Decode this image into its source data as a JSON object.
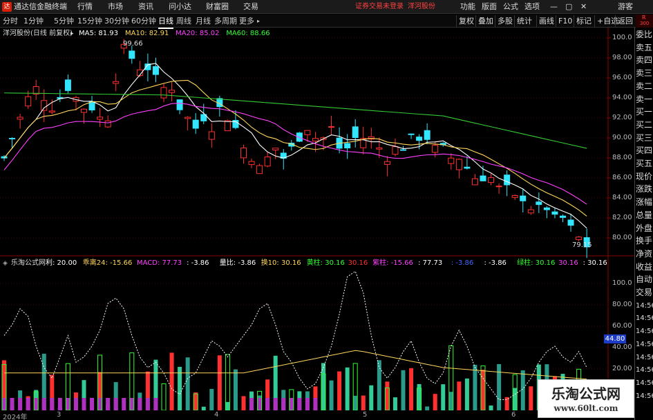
{
  "app": {
    "logo_text": "达",
    "title": "通达信金融终端",
    "menus": [
      "行情",
      "市场",
      "资讯",
      "问小达",
      "财富圈",
      "交易"
    ],
    "login_status": "证券交易未登录",
    "stock_name": "洋河股份",
    "right_menus": [
      "功能",
      "版面",
      "公式",
      "选项"
    ],
    "window_controls": [
      "—",
      "▢",
      "✕"
    ],
    "guest": "游客"
  },
  "timeframes": {
    "items": [
      "分时",
      "1分钟",
      "5分钟",
      "15分钟",
      "30分钟",
      "60分钟",
      "日线",
      "周线",
      "月线",
      "多周期",
      "更多"
    ],
    "active": "日线"
  },
  "toolbar_right": {
    "items": [
      "复权",
      "叠加",
      "多股",
      "统计",
      "画线",
      "F10",
      "标记",
      "+自选",
      "返回"
    ],
    "corner_top": "R",
    "corner_bottom": "300"
  },
  "price_panel": {
    "title": "洋河股份(日线 前复权)",
    "ma_items": [
      {
        "label": "MA5: 81.93",
        "color": "#ffffff"
      },
      {
        "label": "MA10: 82.91",
        "color": "#ffd75a"
      },
      {
        "label": "MA20: 85.02",
        "color": "#ff40ff"
      },
      {
        "label": "MA60: 88.66",
        "color": "#33ff33"
      }
    ],
    "high_label": "99.66",
    "low_label": "79.15",
    "y_labels": [
      "100.0",
      "98.00",
      "96.00",
      "94.00",
      "92.00",
      "90.00",
      "88.00",
      "86.00",
      "84.00",
      "82.00",
      "80.00"
    ]
  },
  "indicator_panel": {
    "title": "乐淘公式网",
    "items": [
      {
        "label": "利: 20.00",
        "color": "#ffffff"
      },
      {
        "label": "乖离24: -15.66",
        "color": "#ffd75a"
      },
      {
        "label": "MACD: 77.73",
        "color": "#ff40ff"
      },
      {
        "label": ": -3.86",
        "color": "#ffffff"
      },
      {
        "label": "量比: -3.86",
        "color": "#ffffff"
      },
      {
        "label": "换10: 30.16",
        "color": "#ffd75a"
      },
      {
        "label": "黄柱: 30.16",
        "color": "#33ff33"
      },
      {
        "label": "30.16",
        "color": "#ff3030"
      },
      {
        "label": "紫柱: -15.66",
        "color": "#ff40ff"
      },
      {
        "label": ": 77.73",
        "color": "#ffffff"
      },
      {
        "label": ": -3.86",
        "color": "#4466ff"
      },
      {
        "label": ": -3.86",
        "color": "#ffffff"
      },
      {
        "label": "绿柱: 30.16",
        "color": "#33ff33"
      },
      {
        "label": "30.16",
        "color": "#ff40ff"
      },
      {
        "label": ": 30.16",
        "color": "#ffffff"
      }
    ],
    "y_labels": [
      "100.0",
      "80.00",
      "60.00",
      "40.00",
      "20.00"
    ],
    "current_value": "44.80"
  },
  "x_axis": {
    "labels": [
      "2024年",
      "3",
      "4",
      "5",
      "6"
    ]
  },
  "sidebar": {
    "items": [
      "委比",
      "卖五",
      "卖四",
      "卖三",
      "卖二",
      "卖一",
      "买一",
      "买二",
      "买三",
      "买四",
      "买五",
      "现价",
      "涨跌",
      "涨幅",
      "总量",
      "外盘",
      "换手",
      "净资",
      "收益",
      "自动",
      "交易",
      "14:56",
      "14:56",
      "14:56",
      "14:56",
      "14:56",
      "14:56",
      "14:56",
      "14:56"
    ]
  },
  "watermark": {
    "title": "乐淘公式网",
    "url": "www.60lt.com"
  },
  "colors": {
    "up": "#ff3030",
    "down": "#33e6ff",
    "ma5": "#ffffff",
    "ma10": "#ffd75a",
    "ma20": "#ff40ff",
    "ma60": "#33cc33"
  }
}
